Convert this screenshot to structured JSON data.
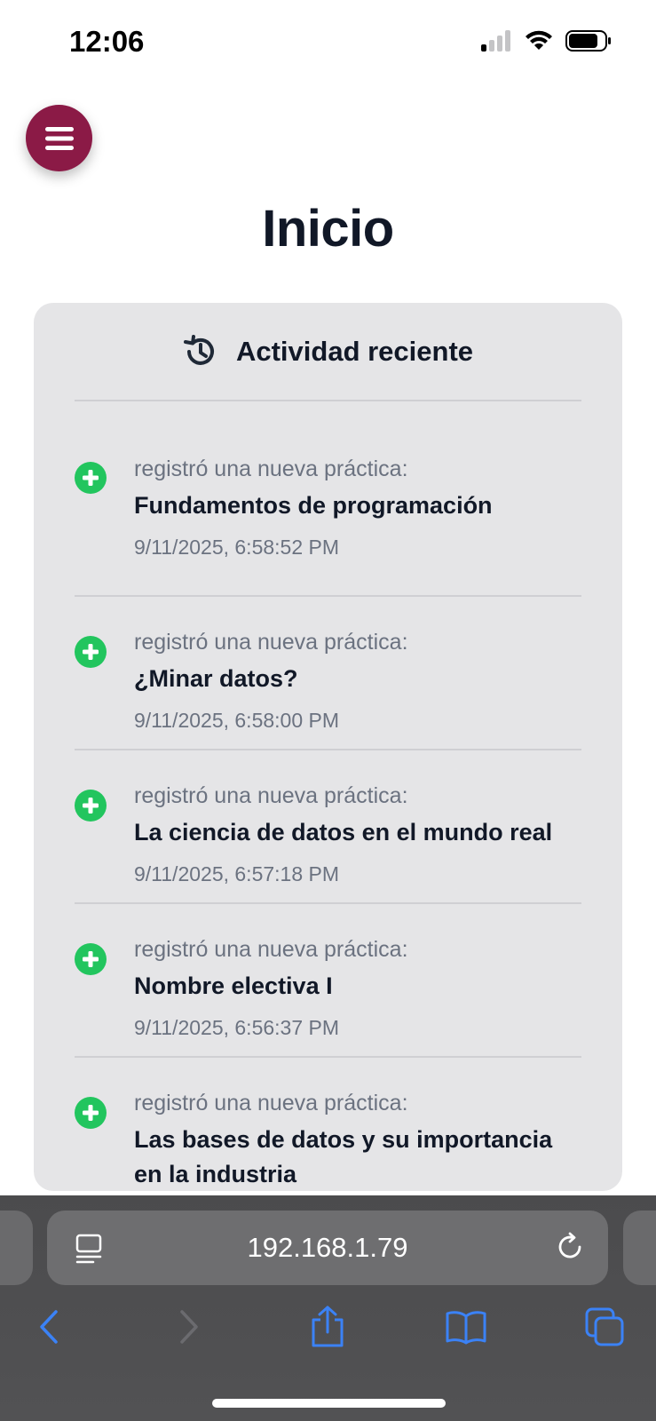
{
  "status_bar": {
    "time": "12:06"
  },
  "page": {
    "title": "Inicio"
  },
  "activity": {
    "header": "Actividad reciente",
    "items": [
      {
        "action": "registró una nueva práctica:",
        "title": "Fundamentos de programación",
        "time": "9/11/2025, 6:58:52 PM"
      },
      {
        "action": "registró una nueva práctica:",
        "title": "¿Minar datos?",
        "time": "9/11/2025, 6:58:00 PM"
      },
      {
        "action": "registró una nueva práctica:",
        "title": "La ciencia de datos en el mundo real",
        "time": "9/11/2025, 6:57:18 PM"
      },
      {
        "action": "registró una nueva práctica:",
        "title": "Nombre electiva I",
        "time": "9/11/2025, 6:56:37 PM"
      },
      {
        "action": "registró una nueva práctica:",
        "title": "Las bases de datos y su importancia en la industria"
      }
    ]
  },
  "browser": {
    "address": "192.168.1.79"
  },
  "colors": {
    "menu_button": "#8b1a46",
    "add_icon": "#22c55e",
    "toolbar_accent": "#3b82f6"
  },
  "icons": {
    "menu": "hamburger-icon",
    "header": "history-icon",
    "item": "plus-circle-icon"
  }
}
